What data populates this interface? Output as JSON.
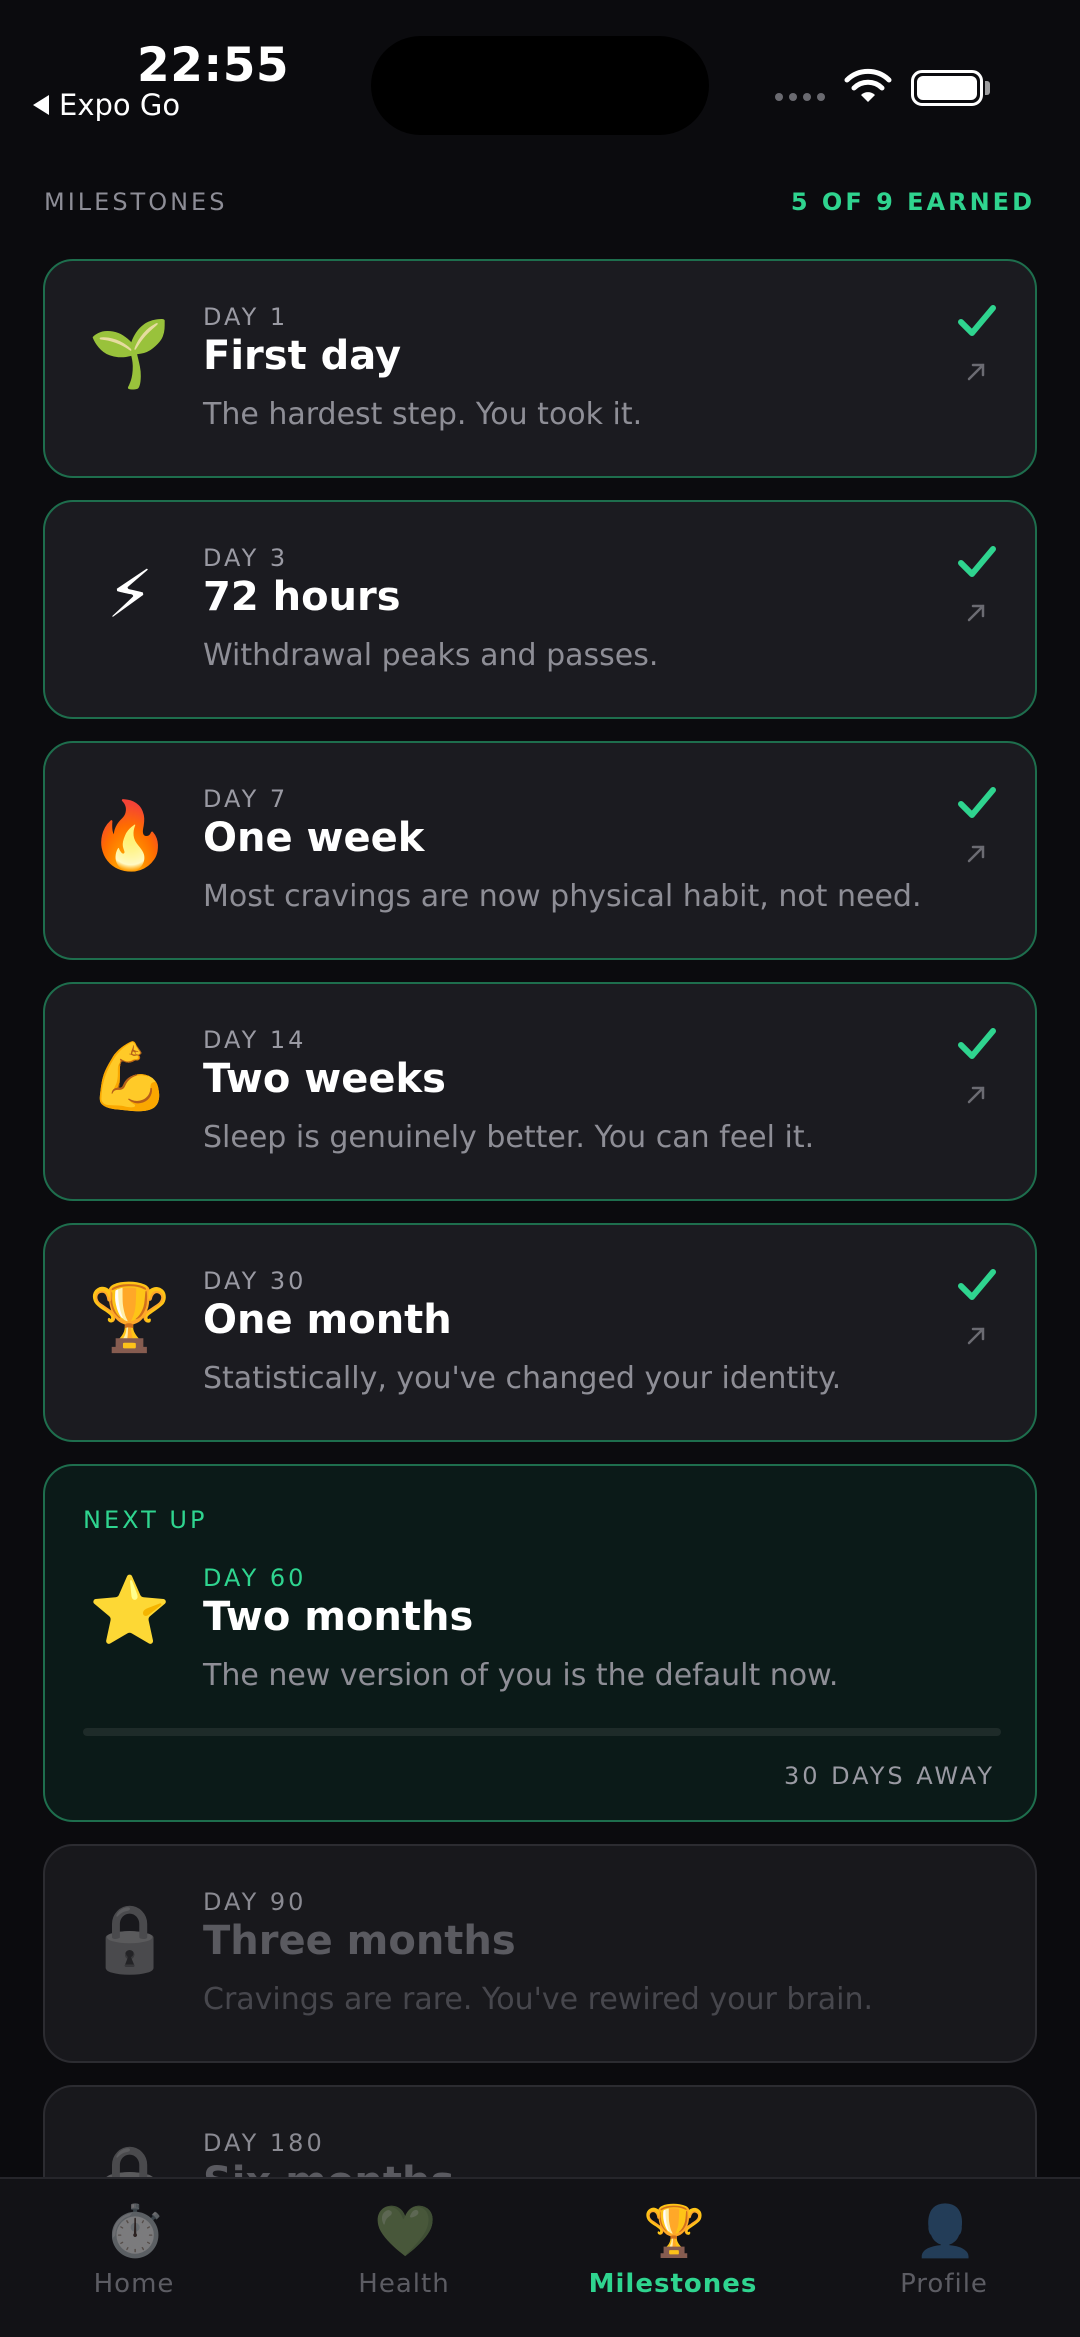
{
  "status_bar": {
    "time": "22:55",
    "back_app": "Expo Go"
  },
  "header": {
    "title": "MILESTONES",
    "earned": "5 OF 9 EARNED"
  },
  "milestones": [
    {
      "emoji": "🌱",
      "icon": "seedling-icon",
      "day": "DAY 1",
      "title": "First day",
      "description": "The hardest step. You took it.",
      "state": "earned"
    },
    {
      "emoji": "⚡",
      "icon": "lightning-icon",
      "day": "DAY 3",
      "title": "72 hours",
      "description": "Withdrawal peaks and passes.",
      "state": "earned"
    },
    {
      "emoji": "🔥",
      "icon": "fire-icon",
      "day": "DAY 7",
      "title": "One week",
      "description": "Most cravings are now physical habit, not need.",
      "state": "earned"
    },
    {
      "emoji": "💪",
      "icon": "flexed-biceps-icon",
      "day": "DAY 14",
      "title": "Two weeks",
      "description": "Sleep is genuinely better. You can feel it.",
      "state": "earned"
    },
    {
      "emoji": "🏆",
      "icon": "trophy-icon",
      "day": "DAY 30",
      "title": "One month",
      "description": "Statistically, you've changed your identity.",
      "state": "earned"
    }
  ],
  "next_milestone": {
    "label": "NEXT UP",
    "emoji": "⭐",
    "icon": "star-icon",
    "day": "DAY 60",
    "title": "Two months",
    "description": "The new version of you is the default now.",
    "progress": 0.0,
    "away": "30 DAYS AWAY"
  },
  "locked_milestones": [
    {
      "emoji": "🔒",
      "icon": "lock-icon",
      "day": "DAY 90",
      "title": "Three months",
      "description": "Cravings are rare. You've rewired your brain."
    },
    {
      "emoji": "🔒",
      "icon": "lock-icon",
      "day": "DAY 180",
      "title": "Six months",
      "description": ""
    }
  ],
  "tabs": [
    {
      "label": "Home",
      "emoji": "⏱️",
      "icon": "stopwatch-icon",
      "active": false
    },
    {
      "label": "Health",
      "emoji": "💚",
      "icon": "green-heart-icon",
      "active": false
    },
    {
      "label": "Milestones",
      "emoji": "🏆",
      "icon": "trophy-icon",
      "active": true
    },
    {
      "label": "Profile",
      "emoji": "👤",
      "icon": "person-silhouette-icon",
      "active": false
    }
  ],
  "colors": {
    "accent": "#2fd48f",
    "background": "#0b0b0e",
    "card": "#1b1b20",
    "earned_border": "#1e6e4d"
  }
}
